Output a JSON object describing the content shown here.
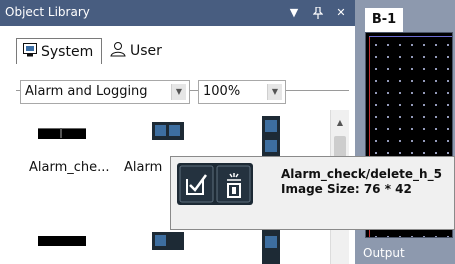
{
  "object_library": {
    "title": "Object Library",
    "title_buttons": {
      "menu_icon": "dropdown-triangle",
      "pin_icon": "pin",
      "close_icon": "close"
    },
    "tabs": [
      {
        "label": "System",
        "icon": "system-icon",
        "active": true
      },
      {
        "label": "User",
        "icon": "user-icon",
        "active": false
      }
    ],
    "category_select": {
      "value": "Alarm and Logging"
    },
    "zoom_select": {
      "value": "100%"
    },
    "items": [
      {
        "label": "Alarm_che..."
      },
      {
        "label": "Alarm"
      }
    ]
  },
  "tooltip": {
    "name": "Alarm_check/delete_h_5",
    "size": "Image Size: 76 * 42"
  },
  "document": {
    "tab_label": "B-1",
    "output_label": "Output"
  },
  "colors": {
    "titlebar": "#485d80",
    "workspace": "#8d99ae",
    "canvas": "#000000",
    "tile_dark": "#1d2a35"
  }
}
